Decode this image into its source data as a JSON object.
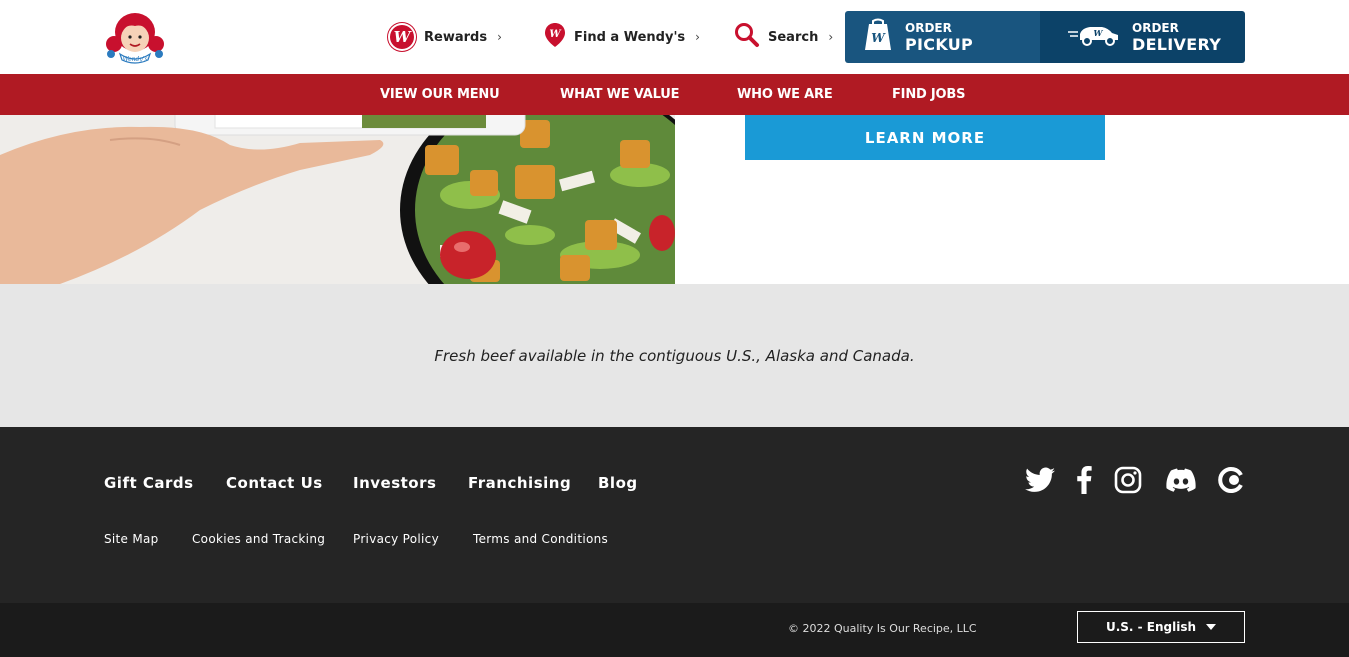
{
  "header": {
    "logo_name": "wendys-logo",
    "rewards_label": "Rewards",
    "find_label": "Find a Wendy's",
    "search_label": "Search",
    "chevron": "›",
    "rewards_icon_letter": "W",
    "order_pickup": {
      "small": "ORDER",
      "big": "PICKUP"
    },
    "order_delivery": {
      "small": "ORDER",
      "big": "DELIVERY"
    }
  },
  "nav": {
    "items": [
      "VIEW OUR MENU",
      "WHAT WE VALUE",
      "WHO WE ARE",
      "FIND JOBS"
    ]
  },
  "hero": {
    "learn_more": "LEARN MORE"
  },
  "disclaimer": {
    "text": "Fresh beef available in the contiguous U.S., Alaska and Canada."
  },
  "footer": {
    "main_links": [
      "Gift Cards",
      "Contact Us",
      "Investors",
      "Franchising",
      "Blog"
    ],
    "sub_links": [
      "Site Map",
      "Cookies and Tracking",
      "Privacy Policy",
      "Terms and Conditions"
    ],
    "social": [
      "twitter-icon",
      "facebook-icon",
      "instagram-icon",
      "discord-icon",
      "crunchyroll-icon"
    ],
    "copyright": "© 2022 Quality Is Our Recipe, LLC",
    "language": "U.S. - English"
  },
  "colors": {
    "brand_red": "#b01a23",
    "pickup_blue": "#19557f",
    "delivery_blue": "#0c4268",
    "learn_blue": "#1a9ad6",
    "footer_dark": "#252525"
  }
}
